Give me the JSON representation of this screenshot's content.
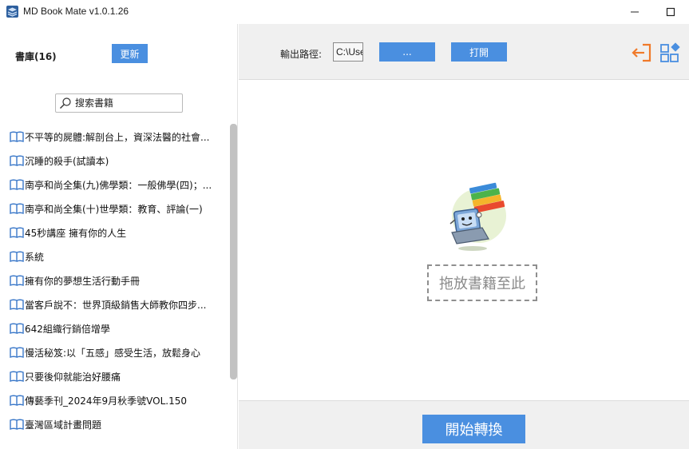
{
  "window": {
    "title": "MD Book Mate v1.0.1.26"
  },
  "sidebar": {
    "library_title": "書庫(16)",
    "refresh_label": "更新",
    "search_placeholder": "搜索書籍",
    "books": [
      "不平等的屍體:解剖台上，資深法醫的社會...",
      "沉睡的殺手(試讀本)",
      "南亭和尚全集(九)佛學類：一般佛學(四)；...",
      "南亭和尚全集(十)世學類：教育、評論(一)",
      "45秒講座  擁有你的人生",
      "系統",
      "擁有你的夢想生活行動手冊",
      "當客戶說不：世界頂級銷售大師教你四步...",
      "642組織行銷倍增學",
      "慢活秘笈:以「五感」感受生活，放鬆身心",
      "只要後仰就能治好腰痛",
      "傳藝季刊_2024年9月秋季號VOL.150",
      "臺灣區域計畫問題"
    ]
  },
  "toolbar": {
    "output_path_label": "輸出路徑:",
    "output_path_value": "C:\\Use",
    "browse_label": "...",
    "open_label": "打開",
    "exit_icon": "exit-icon",
    "grid_icon": "apps-grid-icon"
  },
  "drop_area": {
    "prompt": "拖放書籍至此"
  },
  "bottom": {
    "start_label": "開始轉換"
  },
  "colors": {
    "accent": "#4a8fe0",
    "orange": "#f07a2a",
    "panel": "#f0f0f0"
  }
}
